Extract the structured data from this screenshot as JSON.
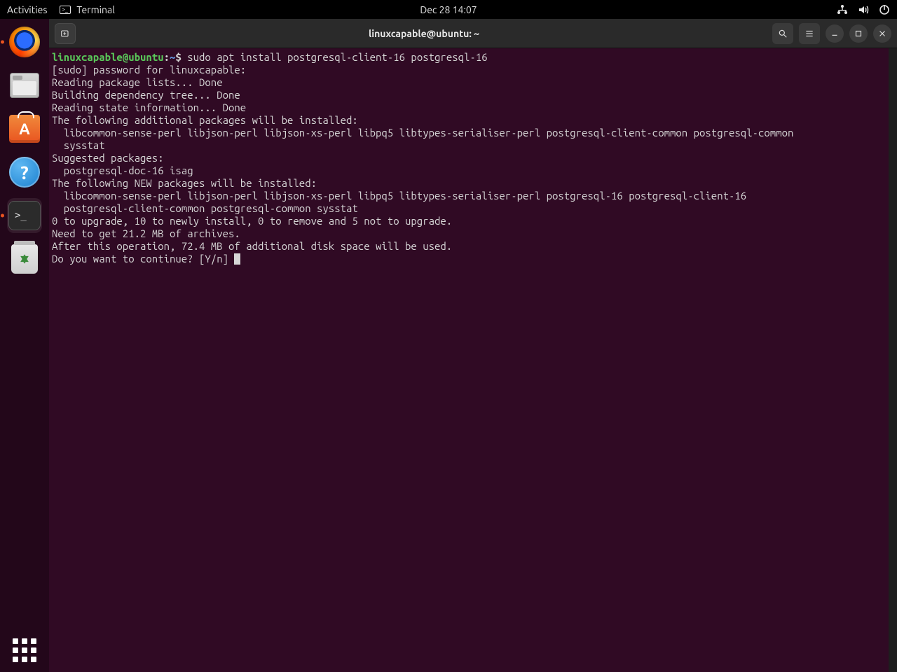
{
  "topbar": {
    "activities": "Activities",
    "app_label": "Terminal",
    "clock": "Dec 28  14:07"
  },
  "dock": {
    "items": [
      "firefox",
      "files",
      "software",
      "help",
      "terminal",
      "trash"
    ]
  },
  "window": {
    "title": "linuxcapable@ubuntu: ~"
  },
  "terminal": {
    "prompt_user": "linuxcapable@ubuntu",
    "prompt_sep": ":",
    "prompt_path": "~",
    "prompt_dollar": "$ ",
    "command": "sudo apt install postgresql-client-16 postgresql-16",
    "lines": [
      "[sudo] password for linuxcapable:",
      "Reading package lists... Done",
      "Building dependency tree... Done",
      "Reading state information... Done",
      "The following additional packages will be installed:",
      "  libcommon-sense-perl libjson-perl libjson-xs-perl libpq5 libtypes-serialiser-perl postgresql-client-common postgresql-common",
      "  sysstat",
      "Suggested packages:",
      "  postgresql-doc-16 isag",
      "The following NEW packages will be installed:",
      "  libcommon-sense-perl libjson-perl libjson-xs-perl libpq5 libtypes-serialiser-perl postgresql-16 postgresql-client-16",
      "  postgresql-client-common postgresql-common sysstat",
      "0 to upgrade, 10 to newly install, 0 to remove and 5 not to upgrade.",
      "Need to get 21.2 MB of archives.",
      "After this operation, 72.4 MB of additional disk space will be used.",
      "Do you want to continue? [Y/n] "
    ]
  }
}
